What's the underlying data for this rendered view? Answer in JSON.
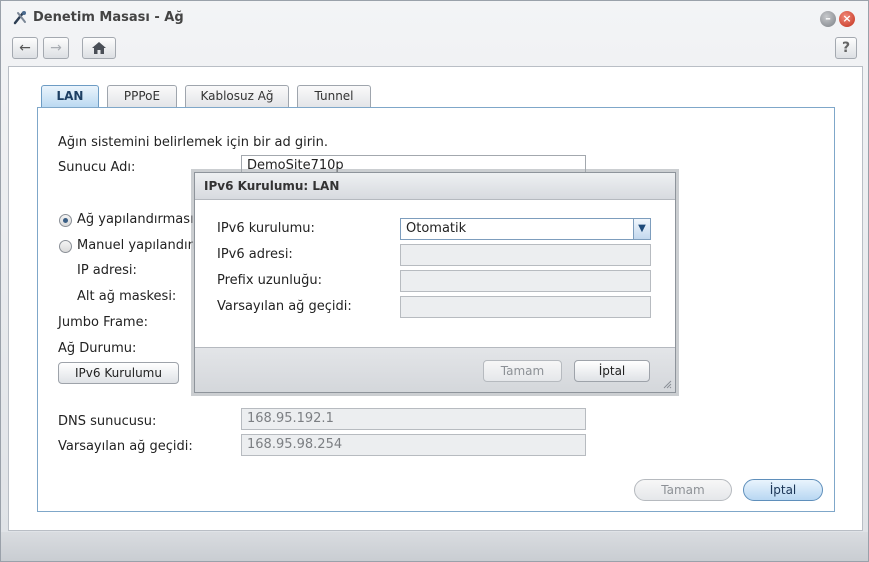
{
  "window": {
    "title": "Denetim Masası - Ağ",
    "help_label": "?"
  },
  "tabs": [
    "LAN",
    "PPPoE",
    "Kablosuz Ağ",
    "Tunnel"
  ],
  "form": {
    "intro": "Ağın sistemini belirlemek için bir ad girin.",
    "server_name_label": "Sunucu Adı:",
    "server_name_value": "DemoSite710p",
    "radio_auto_label": "Ağ yapılandırmasın",
    "radio_manual_label": "Manuel yapılandırm",
    "ip_label": "IP adresi:",
    "subnet_label": "Alt ağ maskesi:",
    "jumbo_label": "Jumbo Frame:",
    "status_label": "Ağ Durumu:",
    "ipv6_button": "IPv6 Kurulumu",
    "dns_label": "DNS sunucusu:",
    "dns_value": "168.95.192.1",
    "gateway_label": "Varsayılan ağ geçidi:",
    "gateway_value": "168.95.98.254",
    "ok_button": "Tamam",
    "cancel_button": "İptal"
  },
  "dialog": {
    "title": "IPv6 Kurulumu: LAN",
    "setup_label": "IPv6 kurulumu:",
    "setup_value": "Otomatik",
    "address_label": "IPv6 adresi:",
    "prefix_label": "Prefix uzunluğu:",
    "gateway_label": "Varsayılan ağ geçidi:",
    "ok_button": "Tamam",
    "cancel_button": "İptal"
  }
}
